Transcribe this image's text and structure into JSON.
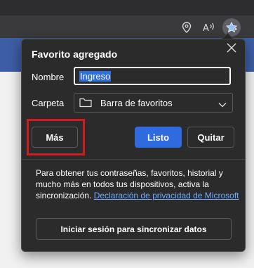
{
  "popup": {
    "title": "Favorito agregado",
    "name_label": "Nombre",
    "name_value": "Ingreso",
    "folder_label": "Carpeta",
    "folder_value": "Barra de favoritos",
    "more_button": "Más",
    "done_button": "Listo",
    "remove_button": "Quitar",
    "sync_message": "Para obtener tus contraseñas, favoritos, historial y mucho más en todos tus dispositivos, activa la sincronización.",
    "privacy_link": "Declaración de privacidad de Microsoft",
    "signin_button": "Iniciar sesión para sincronizar datos"
  },
  "icons": {
    "location": "location-pin-icon",
    "read_aloud": "read-aloud-icon",
    "favorites": "favorite-star-icon",
    "close": "close-icon",
    "folder": "folder-icon",
    "chevron": "chevron-down-icon"
  },
  "colors": {
    "popup_bg": "#2b2b2b",
    "accent": "#2f6bde",
    "link": "#6ea8ff",
    "highlight": "#d01c1c",
    "page_strip": "#3d5ea6"
  }
}
